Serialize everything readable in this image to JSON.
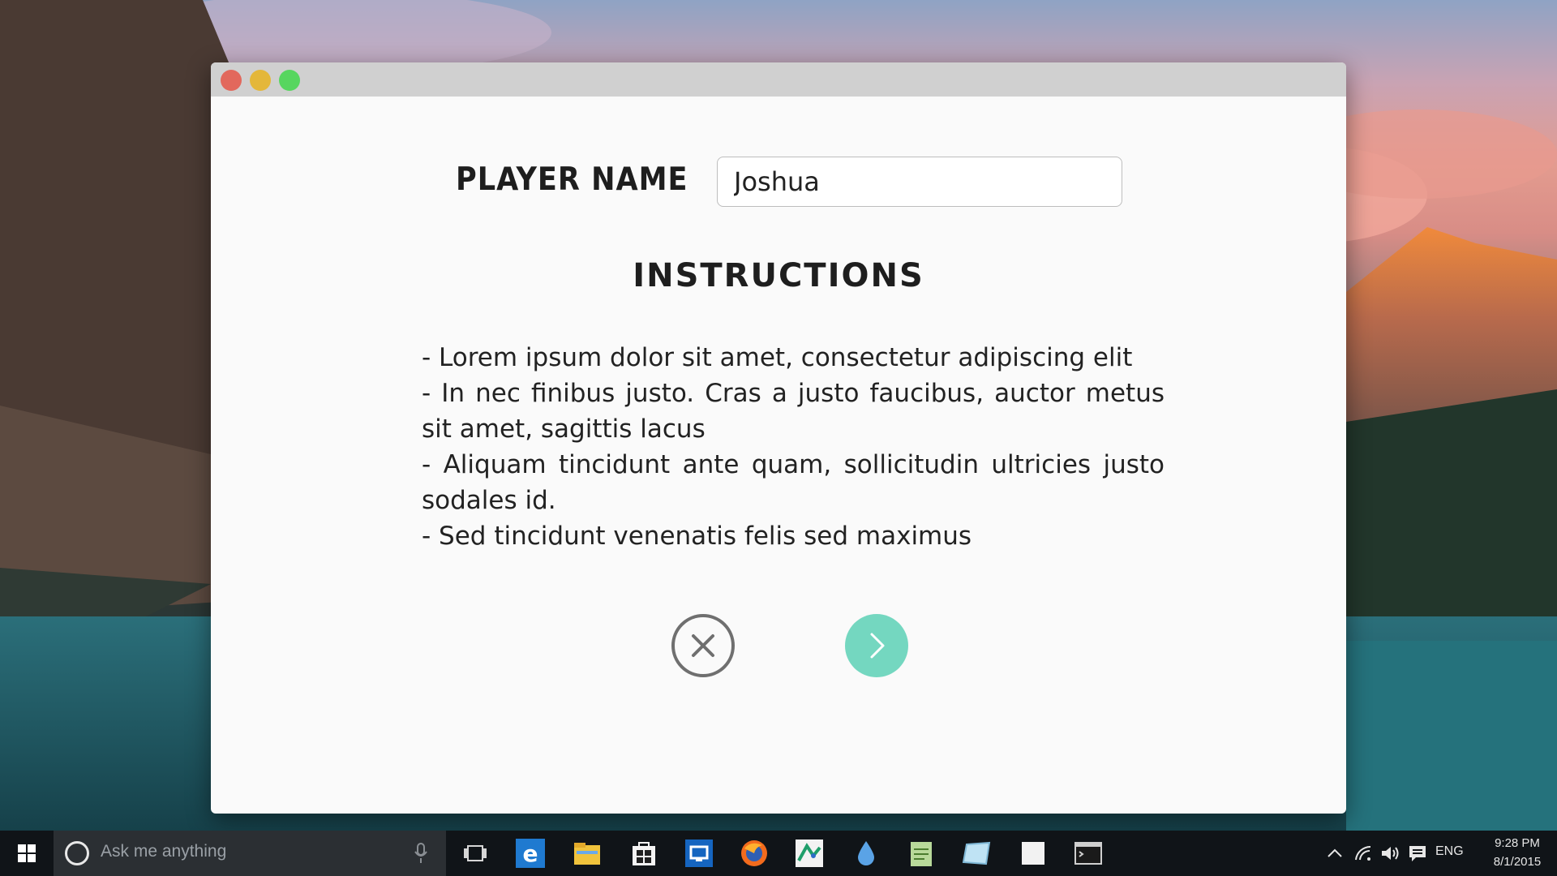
{
  "window": {
    "controls": {
      "close": {
        "icon": "close-dot-icon",
        "color": "#e2685c"
      },
      "minimize": {
        "icon": "minimize-dot-icon",
        "color": "#e4b73a"
      },
      "maximize": {
        "icon": "maximize-dot-icon",
        "color": "#57d65f"
      }
    }
  },
  "form": {
    "player_label": "Player Name",
    "player_value": "Joshua"
  },
  "instructions": {
    "heading": "Instructions",
    "items": [
      "- Lorem ipsum dolor sit amet, consectetur adipiscing elit",
      "- In nec finibus justo. Cras a justo faucibus, auctor metus sit amet, sagittis lacus",
      "- Aliquam tincidunt ante quam, sollicitudin ultricies justo sodales id.",
      "- Sed tincidunt venenatis felis sed maximus"
    ]
  },
  "actions": {
    "cancel": {
      "icon": "close-circle-icon",
      "color": "#6f6f6f"
    },
    "next": {
      "icon": "chevron-right-icon",
      "color": "#74d7c0"
    }
  },
  "taskbar": {
    "search_placeholder": "Ask me anything",
    "apps": [
      {
        "name": "task-view-icon"
      },
      {
        "name": "edge-icon"
      },
      {
        "name": "file-explorer-icon"
      },
      {
        "name": "store-icon"
      },
      {
        "name": "remote-desktop-icon"
      },
      {
        "name": "firefox-icon"
      },
      {
        "name": "maps-app-icon"
      },
      {
        "name": "water-drop-icon"
      },
      {
        "name": "notepad-icon"
      },
      {
        "name": "glass-tile-icon"
      },
      {
        "name": "blank-window-icon"
      },
      {
        "name": "terminal-icon"
      }
    ],
    "tray": {
      "language": "ENG",
      "time": "9:28 PM",
      "date": "8/1/2015"
    }
  }
}
